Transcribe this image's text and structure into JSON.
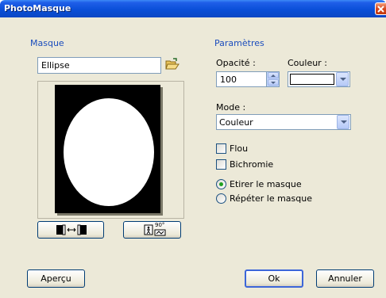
{
  "window": {
    "title": "PhotoMasque"
  },
  "masque": {
    "section_label": "Masque",
    "shape_value": "Ellipse",
    "flip_icon": "flip-horizontal-icon",
    "rotate_icon": "rotate-90-icon",
    "rotate_badge": "90°"
  },
  "parametres": {
    "section_label": "Paramètres",
    "opacity_label": "Opacité :",
    "opacity_value": "100",
    "color_label": "Couleur :",
    "color_value": "#ffffff",
    "mode_label": "Mode :",
    "mode_value": "Couleur",
    "flou_label": "Flou",
    "flou_checked": false,
    "bichromie_label": "Bichromie",
    "bichromie_checked": false,
    "stretch_label": "Etirer le masque",
    "repeat_label": "Répéter le masque",
    "selected_option": "Etirer le masque"
  },
  "buttons": {
    "preview": "Aperçu",
    "ok": "Ok",
    "cancel": "Annuler"
  },
  "colors": {
    "titlebar": "#0a4fd8",
    "dialog_bg": "#ece9d8",
    "section_text": "#1b4dbd",
    "input_border": "#7f9db9"
  }
}
